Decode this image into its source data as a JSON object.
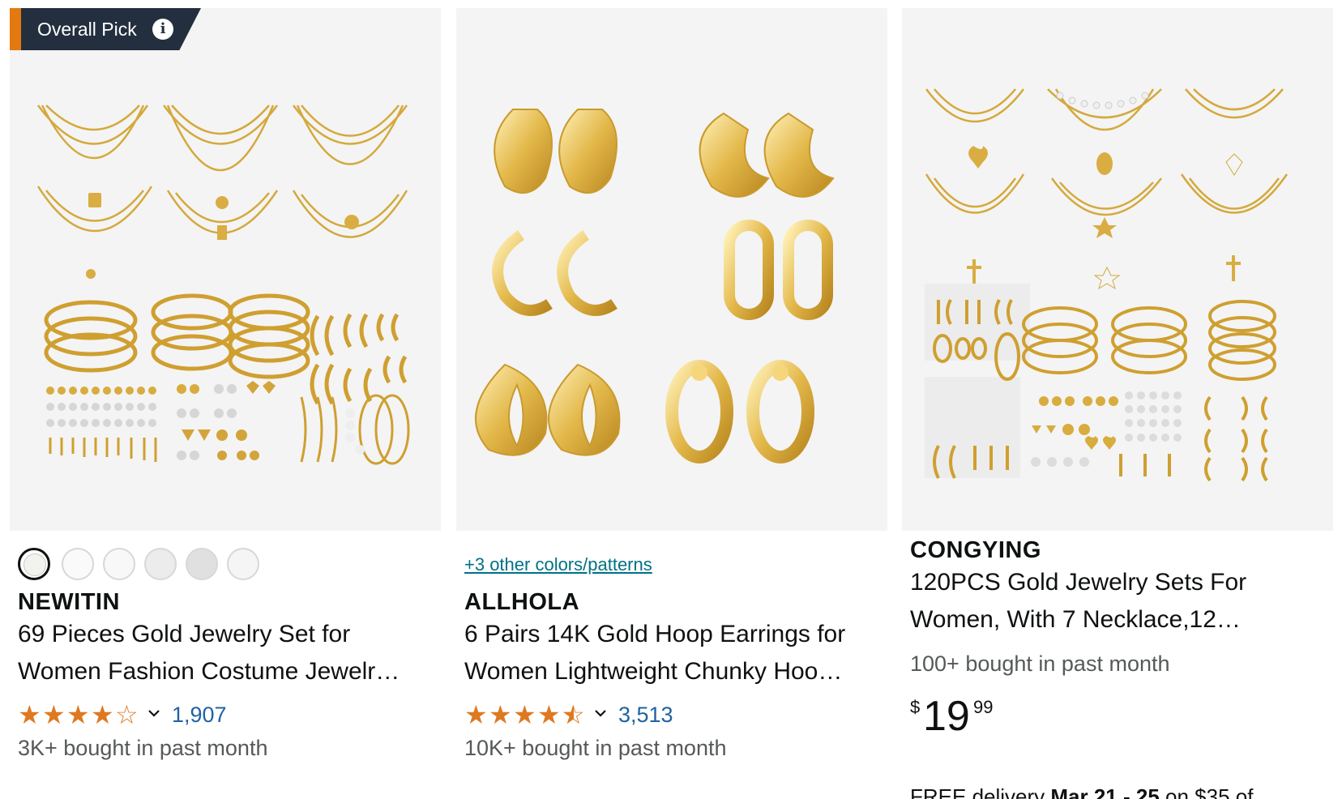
{
  "colors": {
    "badge_bg": "#232f3e",
    "badge_accent": "#e47911",
    "star": "#de7921",
    "link": "#007185",
    "review_count": "#2162a1",
    "muted_text": "#565959",
    "image_bg": "#f4f4f4"
  },
  "products": [
    {
      "badge": {
        "label": "Overall Pick",
        "icon": "info-icon"
      },
      "image_alt": "gold necklaces, bracelets and earrings set",
      "swatch_count": 6,
      "brand": "NEWITIN",
      "title_line1": "69 Pieces Gold Jewelry Set for",
      "title_line2": "Women Fashion Costume Jewelr…",
      "rating": 4.0,
      "rating_stars": "4 of 5",
      "review_count": "1,907",
      "bought": "3K+ bought in past month"
    },
    {
      "more_colors": "+3 other colors/patterns",
      "image_alt": "six pairs of gold hoop earrings",
      "brand": "ALLHOLA",
      "title_line1": "6 Pairs 14K Gold Hoop Earrings for",
      "title_line2": "Women Lightweight Chunky Hoo…",
      "rating": 4.5,
      "rating_stars": "4.5 of 5",
      "review_count": "3,513",
      "bought": "10K+ bought in past month"
    },
    {
      "image_alt": "gold jewelry set with necklaces, bracelets and earrings",
      "brand": "CONGYING",
      "title_line1": "120PCS Gold Jewelry Sets For",
      "title_line2": "Women, With 7 Necklace,12…",
      "bought": "100+ bought in past month",
      "price": {
        "symbol": "$",
        "whole": "19",
        "fraction": "99"
      },
      "delivery": {
        "prefix": "FREE delivery ",
        "dates": "Mar 21 - 25",
        "suffix": " on $35 of"
      }
    }
  ]
}
